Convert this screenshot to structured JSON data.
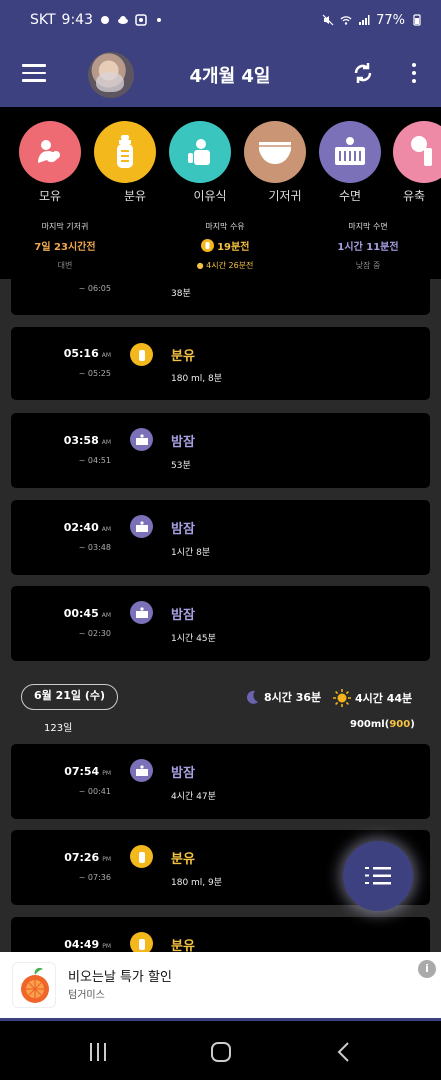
{
  "status_bar": {
    "carrier": "SKT",
    "time": "9:43",
    "battery": "77%"
  },
  "app_bar": {
    "title": "4개월 4일"
  },
  "categories": [
    {
      "label": "모유",
      "color": "#ef6b74",
      "icon": "breastfeed-icon"
    },
    {
      "label": "분유",
      "color": "#f3b81c",
      "icon": "bottle-icon"
    },
    {
      "label": "이유식",
      "color": "#3bc5bf",
      "icon": "baby-food-icon"
    },
    {
      "label": "기저귀",
      "color": "#c99574",
      "icon": "diaper-icon"
    },
    {
      "label": "수면",
      "color": "#7a71b8",
      "icon": "crib-icon"
    },
    {
      "label": "유축",
      "color": "#ef8aa6",
      "icon": "pump-icon"
    }
  ],
  "summary": {
    "diaper": {
      "heading": "마지막 기저귀",
      "value": "7일 23시간전",
      "sub": "대변"
    },
    "feeding": {
      "heading": "마지막 수유",
      "value": "19분전",
      "sub": "4시간 26분전"
    },
    "sleep": {
      "heading": "마지막 수면",
      "value": "1시간 11분전",
      "sub": "낮잠 중"
    }
  },
  "records_top": [
    {
      "time": "",
      "ampm": "",
      "end": "~ 06:05",
      "type": "sleep",
      "name": "",
      "detail": "38분"
    },
    {
      "time": "05:16",
      "ampm": "AM",
      "end": "~ 05:25",
      "type": "formula",
      "name": "분유",
      "detail": "180 ml, 8분"
    },
    {
      "time": "03:58",
      "ampm": "AM",
      "end": "~ 04:51",
      "type": "sleep",
      "name": "밤잠",
      "detail": "53분"
    },
    {
      "time": "02:40",
      "ampm": "AM",
      "end": "~ 03:48",
      "type": "sleep",
      "name": "밤잠",
      "detail": "1시간 8분"
    },
    {
      "time": "00:45",
      "ampm": "AM",
      "end": "~ 02:30",
      "type": "sleep",
      "name": "밤잠",
      "detail": "1시간 45분"
    }
  ],
  "day_header": {
    "date": "6월 21일 (수)",
    "day_count": "123일",
    "night_sleep": "8시간 36분",
    "day_sleep": "4시간 44분",
    "total_volume": "900ml",
    "total_formula": "900"
  },
  "records_bottom": [
    {
      "time": "07:54",
      "ampm": "PM",
      "end": "~ 00:41",
      "type": "sleep",
      "name": "밤잠",
      "detail": "4시간 47분"
    },
    {
      "time": "07:26",
      "ampm": "PM",
      "end": "~ 07:36",
      "type": "formula",
      "name": "분유",
      "detail": "180 ml, 9분"
    },
    {
      "time": "04:49",
      "ampm": "PM",
      "end": "",
      "type": "formula",
      "name": "분유",
      "detail": ""
    }
  ],
  "ad": {
    "title": "비오는날 특가 할인",
    "advertiser": "텀거미스"
  }
}
